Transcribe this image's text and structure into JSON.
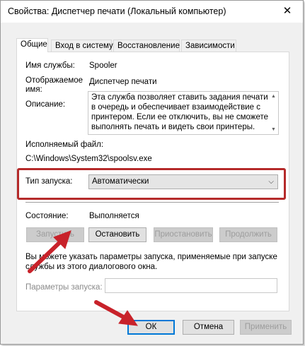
{
  "window": {
    "title": "Свойства: Диспетчер печати (Локальный компьютер)",
    "close_glyph": "✕"
  },
  "tabs": [
    {
      "label": "Общие",
      "active": true
    },
    {
      "label": "Вход в систему",
      "active": false
    },
    {
      "label": "Восстановление",
      "active": false
    },
    {
      "label": "Зависимости",
      "active": false
    }
  ],
  "general": {
    "service_name_label": "Имя службы:",
    "service_name_value": "Spooler",
    "display_name_label_1": "Отображаемое",
    "display_name_label_2": "имя:",
    "display_name_value": "Диспетчер печати",
    "description_label": "Описание:",
    "description_lines": [
      "Эта служба позволяет ставить задания печати",
      "в очередь и обеспечивает взаимодействие с",
      "принтером. Если ее отключить, вы не сможете",
      "выполнять печать и видеть свои принтеры."
    ],
    "exe_label": "Исполняемый файл:",
    "exe_value": "C:\\Windows\\System32\\spoolsv.exe",
    "startup_type_label": "Тип запуска:",
    "startup_type_value": "Автоматически",
    "status_label": "Состояние:",
    "status_value": "Выполняется",
    "buttons": {
      "start": "Запустить",
      "stop": "Остановить",
      "pause": "Приостановить",
      "resume": "Продолжить"
    },
    "hint_line_1": "Вы можете указать параметры запуска, применяемые при запуске",
    "hint_line_2": "службы из этого диалогового окна.",
    "params_label": "Параметры запуска:",
    "params_value": ""
  },
  "footer": {
    "ok": "ОК",
    "cancel": "Отмена",
    "apply": "Применить"
  },
  "colors": {
    "highlight_box": "#b52a2a",
    "arrow": "#c8222a",
    "focus": "#0078d7"
  },
  "icons": {
    "dropdown": "chevron-down-icon",
    "close": "close-icon"
  }
}
